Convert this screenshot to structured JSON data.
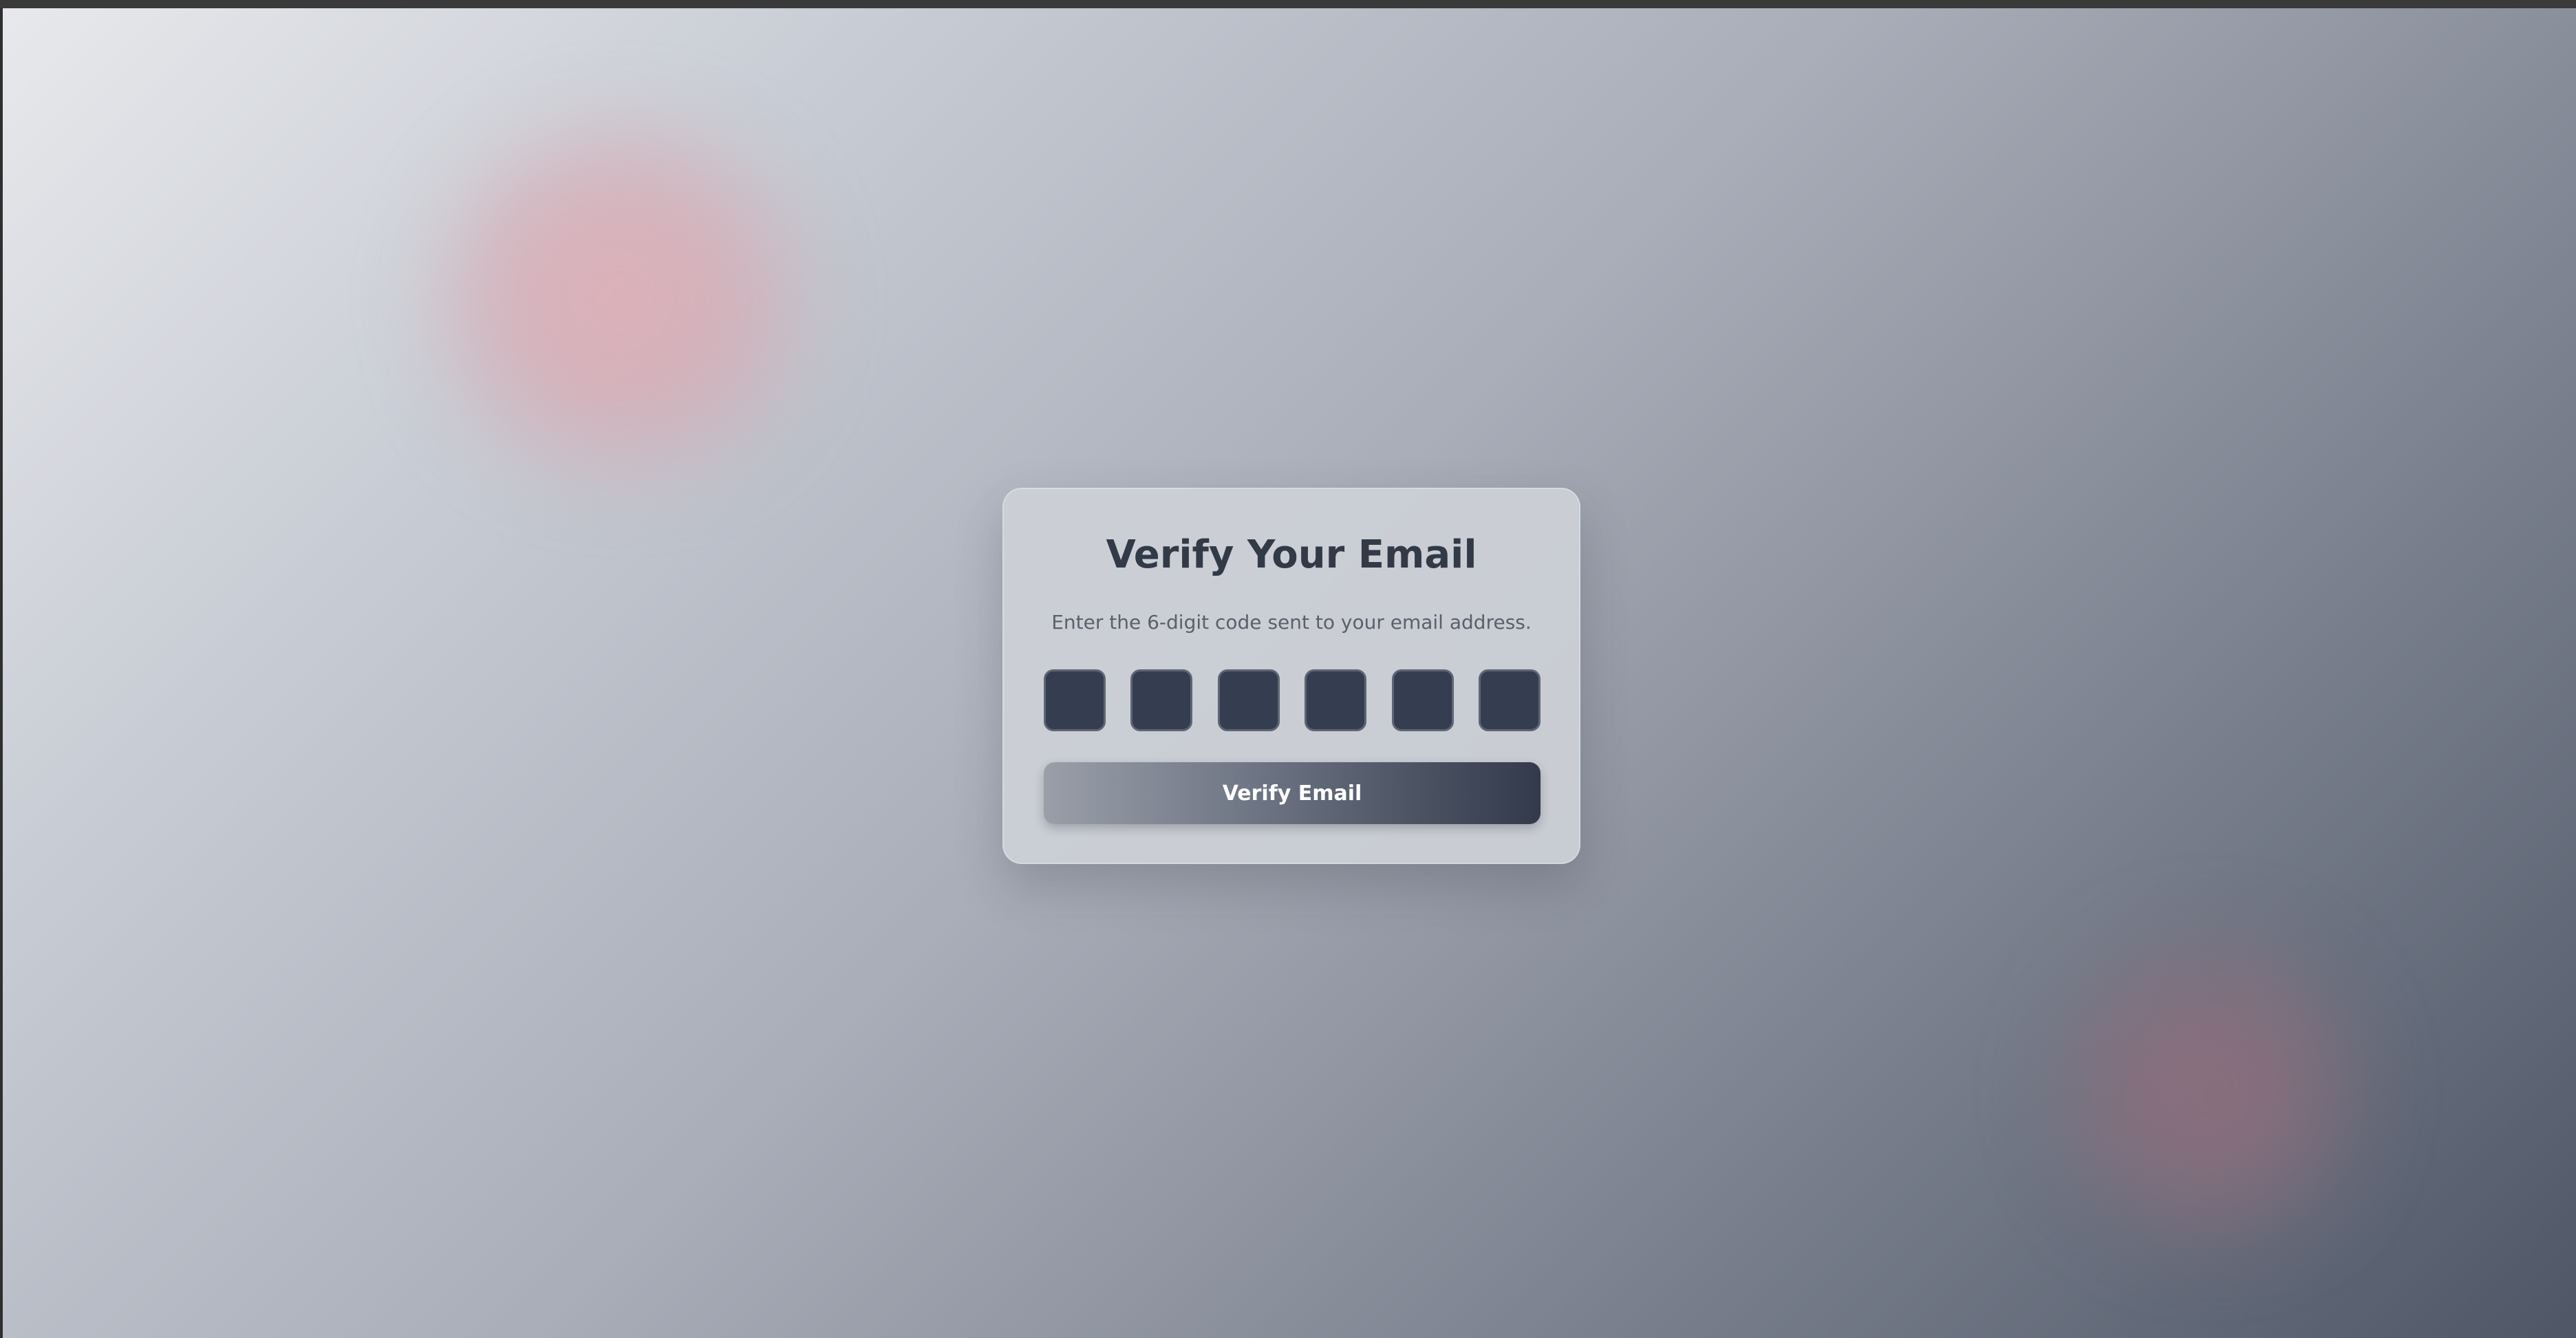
{
  "card": {
    "title": "Verify Your Email",
    "subtitle": "Enter the 6-digit code sent to your email address.",
    "code_digits": [
      "",
      "",
      "",
      "",
      "",
      ""
    ],
    "button_label": "Verify Email"
  },
  "colors": {
    "code_box_bg": "#353e50",
    "title_text": "#333a47",
    "button_end": "#323a4b"
  }
}
